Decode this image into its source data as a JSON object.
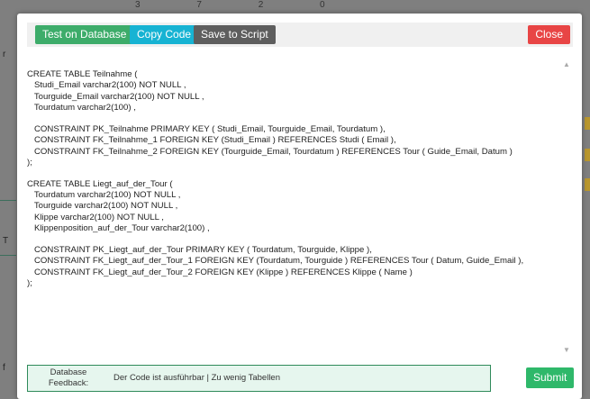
{
  "background": {
    "stats": [
      "3",
      "7",
      "2",
      "0"
    ],
    "edge_glyphs": [
      "f",
      "T",
      "r"
    ]
  },
  "toolbar": {
    "test_label": "Test on Database",
    "copy_label": "Copy Code",
    "save_label": "Save to Script",
    "close_label": "Close"
  },
  "code_lines": [
    "",
    "CREATE TABLE Teilnahme (",
    "   Studi_Email varchar2(100) NOT NULL ,",
    "   Tourguide_Email varchar2(100) NOT NULL ,",
    "   Tourdatum varchar2(100) ,",
    "",
    "   CONSTRAINT PK_Teilnahme PRIMARY KEY ( Studi_Email, Tourguide_Email, Tourdatum ),",
    "   CONSTRAINT FK_Teilnahme_1 FOREIGN KEY (Studi_Email ) REFERENCES Studi ( Email ),",
    "   CONSTRAINT FK_Teilnahme_2 FOREIGN KEY (Tourguide_Email, Tourdatum ) REFERENCES Tour ( Guide_Email, Datum )",
    ");",
    "",
    "CREATE TABLE Liegt_auf_der_Tour (",
    "   Tourdatum varchar2(100) NOT NULL ,",
    "   Tourguide varchar2(100) NOT NULL ,",
    "   Klippe varchar2(100) NOT NULL ,",
    "   Klippenposition_auf_der_Tour varchar2(100) ,",
    "",
    "   CONSTRAINT PK_Liegt_auf_der_Tour PRIMARY KEY ( Tourdatum, Tourguide, Klippe ),",
    "   CONSTRAINT FK_Liegt_auf_der_Tour_1 FOREIGN KEY (Tourdatum, Tourguide ) REFERENCES Tour ( Datum, Guide_Email ),",
    "   CONSTRAINT FK_Liegt_auf_der_Tour_2 FOREIGN KEY (Klippe ) REFERENCES Klippe ( Name )",
    ");"
  ],
  "feedback": {
    "label_line1": "Database",
    "label_line2": "Feedback:",
    "message": "Der Code ist ausführbar | Zu wenig Tabellen"
  },
  "submit_label": "Submit",
  "colors": {
    "test": "#3dac6a",
    "copy": "#17b3d3",
    "save": "#5e5e5e",
    "close": "#e84545",
    "submit": "#2fb86a",
    "feedback_bg": "#e6f6ee",
    "feedback_border": "#2f8a5a"
  },
  "icons": {
    "scroll_up": "▲",
    "scroll_down": "▼"
  }
}
